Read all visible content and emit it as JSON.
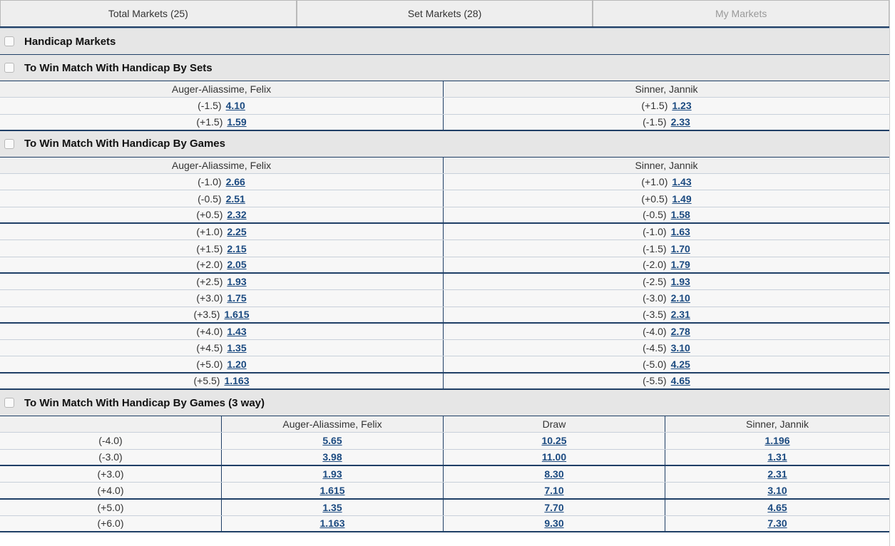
{
  "tabs": [
    {
      "label": "Total Markets (25)"
    },
    {
      "label": "Set Markets (28)"
    },
    {
      "label": "My Markets"
    }
  ],
  "group_title": "Handicap Markets",
  "sets_market": {
    "title": "To Win Match With Handicap By Sets",
    "player1": "Auger-Aliassime, Felix",
    "player2": "Sinner, Jannik",
    "rows": [
      {
        "h1": "(-1.5)",
        "o1": "4.10",
        "h2": "(+1.5)",
        "o2": "1.23"
      },
      {
        "h1": "(+1.5)",
        "o1": "1.59",
        "h2": "(-1.5)",
        "o2": "2.33"
      }
    ]
  },
  "games_market": {
    "title": "To Win Match With Handicap By Games",
    "player1": "Auger-Aliassime, Felix",
    "player2": "Sinner, Jannik",
    "rows": [
      {
        "h1": "(-1.0)",
        "o1": "2.66",
        "h2": "(+1.0)",
        "o2": "1.43"
      },
      {
        "h1": "(-0.5)",
        "o1": "2.51",
        "h2": "(+0.5)",
        "o2": "1.49"
      },
      {
        "h1": "(+0.5)",
        "o1": "2.32",
        "h2": "(-0.5)",
        "o2": "1.58"
      },
      {
        "h1": "(+1.0)",
        "o1": "2.25",
        "h2": "(-1.0)",
        "o2": "1.63"
      },
      {
        "h1": "(+1.5)",
        "o1": "2.15",
        "h2": "(-1.5)",
        "o2": "1.70"
      },
      {
        "h1": "(+2.0)",
        "o1": "2.05",
        "h2": "(-2.0)",
        "o2": "1.79"
      },
      {
        "h1": "(+2.5)",
        "o1": "1.93",
        "h2": "(-2.5)",
        "o2": "1.93"
      },
      {
        "h1": "(+3.0)",
        "o1": "1.75",
        "h2": "(-3.0)",
        "o2": "2.10"
      },
      {
        "h1": "(+3.5)",
        "o1": "1.615",
        "h2": "(-3.5)",
        "o2": "2.31"
      },
      {
        "h1": "(+4.0)",
        "o1": "1.43",
        "h2": "(-4.0)",
        "o2": "2.78"
      },
      {
        "h1": "(+4.5)",
        "o1": "1.35",
        "h2": "(-4.5)",
        "o2": "3.10"
      },
      {
        "h1": "(+5.0)",
        "o1": "1.20",
        "h2": "(-5.0)",
        "o2": "4.25"
      },
      {
        "h1": "(+5.5)",
        "o1": "1.163",
        "h2": "(-5.5)",
        "o2": "4.65"
      }
    ]
  },
  "threeway_market": {
    "title": "To Win Match With Handicap By Games (3 way)",
    "col_empty": "",
    "player1": "Auger-Aliassime, Felix",
    "draw": "Draw",
    "player2": "Sinner, Jannik",
    "rows": [
      {
        "h": "(-4.0)",
        "o1": "5.65",
        "od": "10.25",
        "o2": "1.196"
      },
      {
        "h": "(-3.0)",
        "o1": "3.98",
        "od": "11.00",
        "o2": "1.31"
      },
      {
        "h": "(+3.0)",
        "o1": "1.93",
        "od": "8.30",
        "o2": "2.31"
      },
      {
        "h": "(+4.0)",
        "o1": "1.615",
        "od": "7.10",
        "o2": "3.10"
      },
      {
        "h": "(+5.0)",
        "o1": "1.35",
        "od": "7.70",
        "o2": "4.65"
      },
      {
        "h": "(+6.0)",
        "o1": "1.163",
        "od": "9.30",
        "o2": "7.30"
      }
    ]
  }
}
